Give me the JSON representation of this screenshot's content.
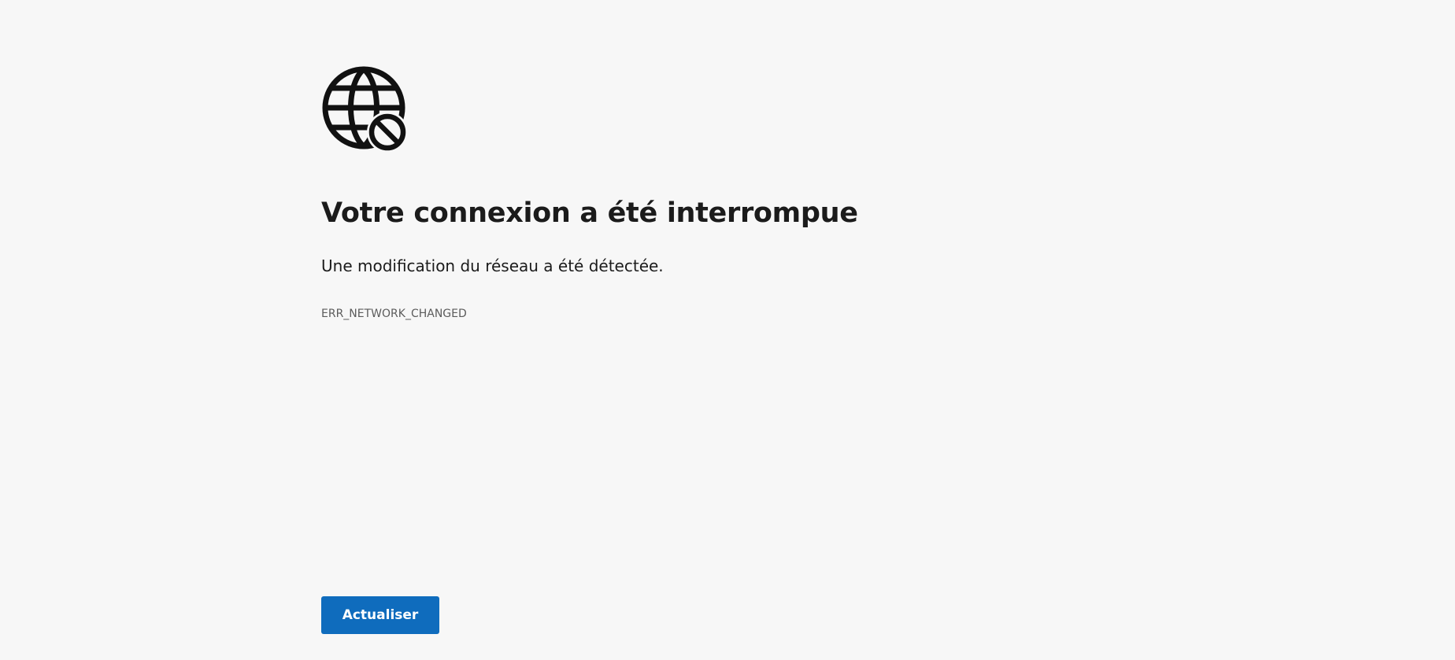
{
  "icon": "globe-blocked-icon",
  "title": "Votre connexion a été interrompue",
  "description": "Une modification du réseau a été détectée.",
  "error_code": "ERR_NETWORK_CHANGED",
  "reload_button_label": "Actualiser",
  "colors": {
    "background": "#f7f7f7",
    "text": "#1b1b1b",
    "secondary_text": "#5c5c5c",
    "accent": "#0f6cbd"
  }
}
